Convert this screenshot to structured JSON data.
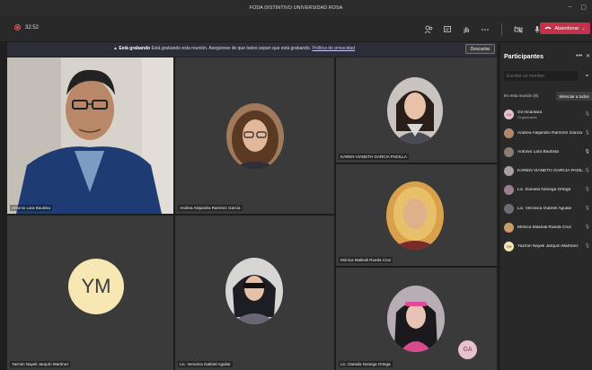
{
  "window": {
    "title": "FODA DISTINTIVO UNIVERSIDAD ROSA",
    "minimize": "–",
    "maximize": "▢"
  },
  "toolbar": {
    "timer": "32:52",
    "leave_label": "Abandonar"
  },
  "banner": {
    "bold_text": "Está grabando",
    "message": " Está grabando esta reunión. Asegúrese de que todos sepan que está grabando.",
    "link_text": "Política de privacidad",
    "dismiss_label": "Descartar"
  },
  "tiles": [
    {
      "name": "Antonio Lara Bautista"
    },
    {
      "name": "Andrea Alejandra Ramírez García"
    },
    {
      "name": "KAREN VIANETH GARCIA PADILLA"
    },
    {
      "name": "Mónica Malinali Rueda Cruz"
    },
    {
      "name": "Yazmin Nayeli Jarquín Martínez",
      "initials": "YM"
    },
    {
      "name": "Lic. Veronica Gabriel Aguilar"
    },
    {
      "name": "Lic. Daniela Noriega Ortega"
    }
  ],
  "floating_avatar": {
    "initials": "GA"
  },
  "participants": {
    "title": "Participantes",
    "search_placeholder": "Escribe un nombre",
    "section_label": "En esta reunión (8)",
    "mute_all_label": "Silenciar a todos",
    "list": [
      {
        "name": "Gil Alcantara",
        "role": "Organizador",
        "initials": "GA",
        "color": "#e6c3cc"
      },
      {
        "name": "Andrea Alejandro Ramírez García",
        "role": "",
        "initials": "",
        "color": "#b08a6a"
      },
      {
        "name": "Antonio Lara Bautista",
        "role": "",
        "initials": "",
        "color": "#8a7d70"
      },
      {
        "name": "KAREN VIANETH GARCIA PADIL...",
        "role": "",
        "initials": "",
        "color": "#a7a0a0"
      },
      {
        "name": "Lic. Daniela Noriega Ortega",
        "role": "",
        "initials": "",
        "color": "#9a7f90"
      },
      {
        "name": "Lic. Veronica Gabriel Aguilar",
        "role": "",
        "initials": "",
        "color": "#6f6a72"
      },
      {
        "name": "Mónica Malinali Rueda Cruz",
        "role": "",
        "initials": "",
        "color": "#c99a6a"
      },
      {
        "name": "Yazmin Nayeli Jarquín Martínez",
        "role": "",
        "initials": "YM",
        "color": "#f6e7b3"
      }
    ]
  },
  "colors": {
    "leave": "#c4314b",
    "recording": "#e05a5a",
    "panel": "#292929"
  }
}
